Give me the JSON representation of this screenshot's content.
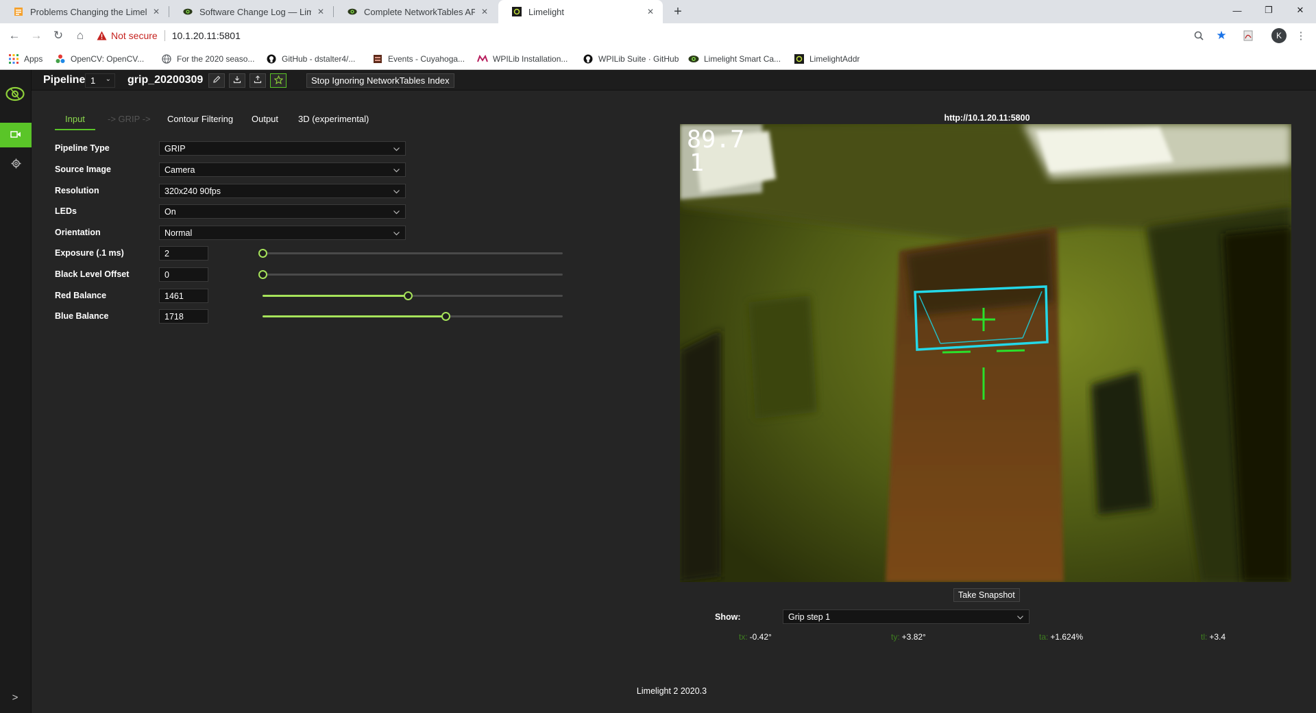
{
  "browser": {
    "tabs": [
      {
        "title": "Problems Changing the Limeligh",
        "favicon": "ms-word-icon"
      },
      {
        "title": "Software Change Log — Limeligh",
        "favicon": "limelight-eye-icon"
      },
      {
        "title": "Complete NetworkTables API — l",
        "favicon": "limelight-eye-icon"
      },
      {
        "title": "Limelight",
        "favicon": "limelight-app-icon"
      }
    ],
    "not_secure": "Not secure",
    "url": "10.1.20.11:5801",
    "profile_initial": "K",
    "bookmarks": [
      {
        "label": "Apps",
        "icon": "apps-grid-icon"
      },
      {
        "label": "OpenCV: OpenCV...",
        "icon": "opencv-icon"
      },
      {
        "label": "For the 2020 seaso...",
        "icon": "globe-icon"
      },
      {
        "label": "GitHub - dstalter4/...",
        "icon": "github-icon"
      },
      {
        "label": "Events - Cuyahoga...",
        "icon": "events-icon"
      },
      {
        "label": "WPILib Installation...",
        "icon": "wpilib-icon"
      },
      {
        "label": "WPILib Suite · GitHub",
        "icon": "github-icon"
      },
      {
        "label": "Limelight Smart Ca...",
        "icon": "limelight-eye-icon"
      },
      {
        "label": "LimelightAddr",
        "icon": "limelight-app-icon"
      }
    ]
  },
  "app": {
    "pipeline_label": "Pipeline:",
    "pipeline_index": "1",
    "pipeline_name": "grip_20200309",
    "ignore_button": "Stop Ignoring NetworkTables Index",
    "tabs": [
      {
        "label": "Input",
        "state": "active"
      },
      {
        "label": "-> GRIP ->",
        "state": "disabled"
      },
      {
        "label": "Contour Filtering",
        "state": "normal"
      },
      {
        "label": "Output",
        "state": "normal"
      },
      {
        "label": "3D (experimental)",
        "state": "normal"
      }
    ],
    "selects": [
      {
        "label": "Pipeline Type",
        "value": "GRIP"
      },
      {
        "label": "Source Image",
        "value": "Camera"
      },
      {
        "label": "Resolution",
        "value": "320x240 90fps"
      },
      {
        "label": "LEDs",
        "value": "On"
      },
      {
        "label": "Orientation",
        "value": "Normal"
      }
    ],
    "sliders": [
      {
        "label": "Exposure (.1 ms)",
        "value": "2",
        "fraction": 0.0
      },
      {
        "label": "Black Level Offset",
        "value": "0",
        "fraction": 0.0
      },
      {
        "label": "Red Balance",
        "value": "1461",
        "fraction": 0.485
      },
      {
        "label": "Blue Balance",
        "value": "1718",
        "fraction": 0.61
      }
    ],
    "stream_url": "http://10.1.20.11:5800",
    "overlay_fps": "89.7",
    "overlay_count": "1",
    "snapshot_button": "Take Snapshot",
    "show_label": "Show:",
    "show_value": "Grip step 1",
    "readouts": [
      {
        "key": "tx:",
        "value": "-0.42°"
      },
      {
        "key": "ty:",
        "value": "+3.82°"
      },
      {
        "key": "ta:",
        "value": "+1.624%"
      },
      {
        "key": "tl:",
        "value": "+3.4"
      }
    ],
    "version": "Limelight 2 2020.3"
  },
  "colors": {
    "accent": "#5ac528",
    "slider_fill": "#a6e35a",
    "target_box": "#24d8e8",
    "crosshair": "#2be02b"
  }
}
